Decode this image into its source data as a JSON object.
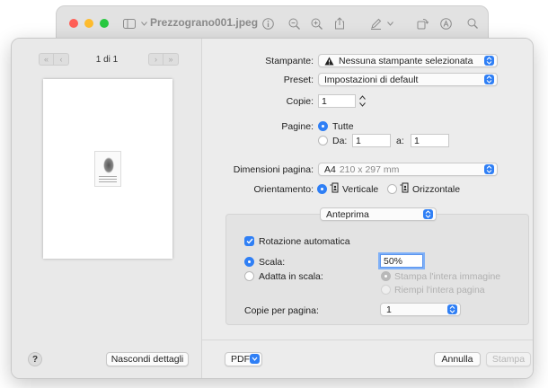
{
  "window": {
    "title": "Prezzograno001.jpeg"
  },
  "nav": {
    "page_count": "1 di 1"
  },
  "printer": {
    "label": "Stampante:",
    "value": "Nessuna stampante selezionata"
  },
  "preset": {
    "label": "Preset:",
    "value": "Impostazioni di default"
  },
  "copies": {
    "label": "Copie:",
    "value": "1"
  },
  "pages": {
    "label": "Pagine:",
    "all_label": "Tutte",
    "from_label": "Da:",
    "from_value": "1",
    "to_label": "a:",
    "to_value": "1"
  },
  "paper": {
    "label": "Dimensioni pagina:",
    "size": "A4",
    "dims": "210 x 297 mm"
  },
  "orientation": {
    "label": "Orientamento:",
    "portrait": "Verticale",
    "landscape": "Orizzontale"
  },
  "section_menu": {
    "value": "Anteprima"
  },
  "preview_options": {
    "auto_rotate": "Rotazione automatica",
    "scale_label": "Scala:",
    "scale_value": "50%",
    "fit_label": "Adatta in scala:",
    "fit_whole": "Stampa l'intera immagine",
    "fill_page": "Riempi l'intera pagina",
    "per_page_label": "Copie per pagina:",
    "per_page_value": "1"
  },
  "footer": {
    "help": "?",
    "hide_details": "Nascondi dettagli",
    "pdf": "PDF",
    "cancel": "Annulla",
    "print": "Stampa"
  },
  "colors": {
    "accent": "#2f7ff5",
    "close": "#ff5f57",
    "minimize": "#febc2e",
    "zoom": "#28c840"
  }
}
